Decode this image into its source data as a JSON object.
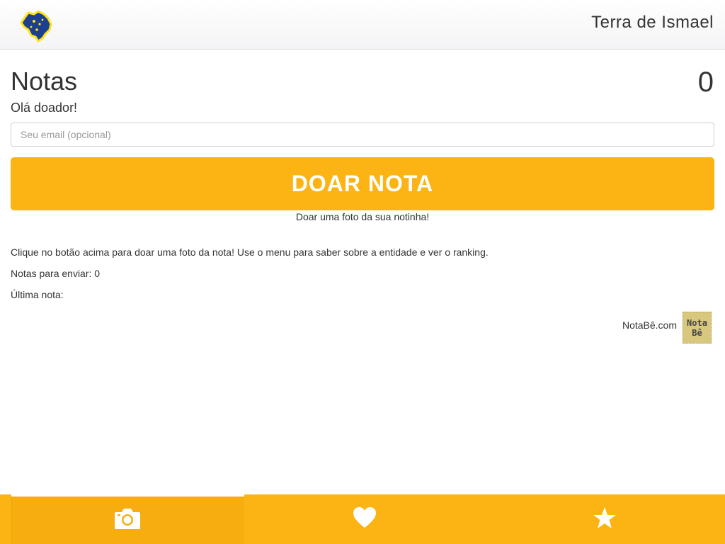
{
  "header": {
    "title": "Terra de Ismael",
    "logo_icon": "brazil-map-logo-icon"
  },
  "main": {
    "title": "Notas",
    "counter": "0",
    "greeting": "Olá doador!",
    "email_placeholder": "Seu email (opcional)",
    "email_value": "",
    "donate_label": "DOAR NOTA",
    "donate_hint": "Doar uma foto da sua notinha!",
    "instructions": "Clique no botão acima para doar uma foto da nota! Use o menu para saber sobre a entidade e ver o ranking.",
    "pending": "Notas para enviar: 0",
    "last_note": "Última nota:",
    "brand_text": "NotaBê.com",
    "brand_logo_line1": "Nota",
    "brand_logo_line2": "Bê"
  },
  "tabs": [
    {
      "icon": "camera-icon",
      "active": true
    },
    {
      "icon": "heart-icon",
      "active": false
    },
    {
      "icon": "star-icon",
      "active": false
    }
  ],
  "colors": {
    "accent": "#fbb413",
    "text": "#333333",
    "logo_blue": "#1d3f8f",
    "logo_yellow": "#ffe21a"
  }
}
